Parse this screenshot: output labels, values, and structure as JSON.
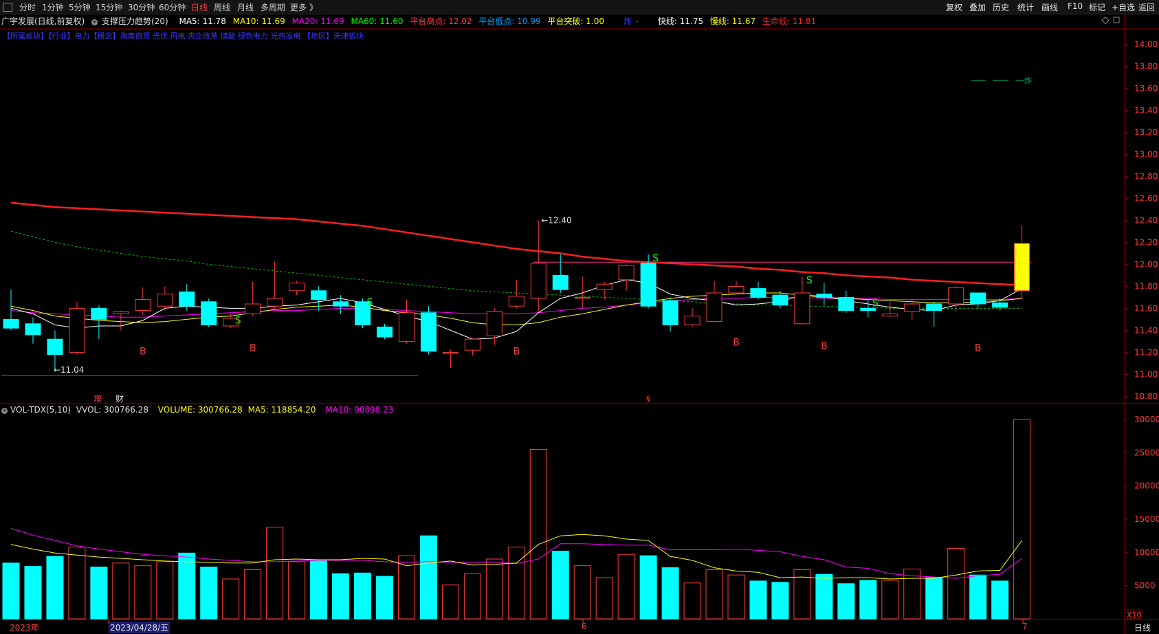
{
  "toolbar": {
    "periods": [
      "分时",
      "1分钟",
      "5分钟",
      "15分钟",
      "30分钟",
      "60分钟",
      "日线",
      "周线",
      "月线",
      "多周期",
      "更多 》"
    ],
    "active_period": "日线",
    "right_buttons": [
      "复权",
      "叠加",
      "历史",
      "统计",
      "画线",
      "F10",
      "标记",
      "+自选",
      "返回"
    ]
  },
  "header": {
    "stock": "广宇发展(日线,前复权)",
    "indicator": "支撑压力趋势(20)",
    "ma5": "MA5: 11.78",
    "ma10": "MA10: 11.69",
    "ma20": "MA20: 11.69",
    "ma60": "MA60: 11.60",
    "platform_high": "平台高点: 12.02",
    "platform_low": "平台低点: 10.99",
    "platform_break": "平台突破: 1.00",
    "zha": "炸",
    "fast_line": "快线: 11.75",
    "slow_line": "慢线: 11.67",
    "life_line": "生命线: 11.81"
  },
  "tags": "【所属板块】【行业】电力【概念】海南自贸 光伏 风电 央企改革 储能 绿色电力 光热发电 【地区】天津板块",
  "price_axis": [
    "14.00",
    "13.80",
    "13.60",
    "13.40",
    "13.20",
    "13.00",
    "12.80",
    "12.60",
    "12.40",
    "12.20",
    "12.00",
    "11.80",
    "11.60",
    "11.40",
    "11.20",
    "11.00",
    "10.80"
  ],
  "annotations": {
    "high": "12.40",
    "low": "11.04",
    "legend_zha": "炸",
    "zeng": "增",
    "cai": "财",
    "s_marks": [
      "S",
      "S",
      "S",
      "S",
      "S"
    ],
    "b_marks": [
      "B",
      "B",
      "B",
      "B",
      "B",
      "B"
    ]
  },
  "volume": {
    "title": "VOL-TDX(5,10)",
    "vvol": "VVOL: 300766.28",
    "volume": "VOLUME: 300766.28",
    "ma5": "MA5: 118854.20",
    "ma10": "MA10: 90898.23",
    "axis": [
      "30000",
      "25000",
      "20000",
      "15000",
      "10000",
      "5000"
    ],
    "unit": "X10"
  },
  "xaxis": {
    "year": "2023年",
    "cursor_date": "2023/04/28/五",
    "m6": "6",
    "m7": "7",
    "period": "日线"
  },
  "colors": {
    "up": "#ff3b3b",
    "down": "#00ffff",
    "ma5": "#ffffff",
    "ma10": "#ffff00",
    "ma20": "#ff00ff",
    "ma60": "#00ff00",
    "life": "#ff2020"
  },
  "chart_data": {
    "type": "candlestick",
    "candles": [
      {
        "o": 11.5,
        "h": 11.77,
        "l": 11.4,
        "c": 11.42
      },
      {
        "o": 11.46,
        "h": 11.52,
        "l": 11.28,
        "c": 11.36
      },
      {
        "o": 11.32,
        "h": 11.4,
        "l": 11.04,
        "c": 11.18
      },
      {
        "o": 11.2,
        "h": 11.66,
        "l": 11.18,
        "c": 11.6
      },
      {
        "o": 11.6,
        "h": 11.63,
        "l": 11.32,
        "c": 11.5
      },
      {
        "o": 11.55,
        "h": 11.58,
        "l": 11.4,
        "c": 11.57
      },
      {
        "o": 11.58,
        "h": 11.79,
        "l": 11.54,
        "c": 11.68
      },
      {
        "o": 11.62,
        "h": 11.8,
        "l": 11.58,
        "c": 11.73
      },
      {
        "o": 11.75,
        "h": 11.82,
        "l": 11.58,
        "c": 11.62
      },
      {
        "o": 11.66,
        "h": 11.69,
        "l": 11.43,
        "c": 11.45
      },
      {
        "o": 11.44,
        "h": 11.55,
        "l": 11.42,
        "c": 11.51
      },
      {
        "o": 11.55,
        "h": 11.84,
        "l": 11.53,
        "c": 11.64
      },
      {
        "o": 11.62,
        "h": 12.03,
        "l": 11.58,
        "c": 11.69
      },
      {
        "o": 11.76,
        "h": 11.85,
        "l": 11.72,
        "c": 11.83
      },
      {
        "o": 11.76,
        "h": 11.8,
        "l": 11.58,
        "c": 11.68
      },
      {
        "o": 11.66,
        "h": 11.72,
        "l": 11.55,
        "c": 11.62
      },
      {
        "o": 11.66,
        "h": 11.69,
        "l": 11.42,
        "c": 11.45
      },
      {
        "o": 11.43,
        "h": 11.46,
        "l": 11.32,
        "c": 11.34
      },
      {
        "o": 11.3,
        "h": 11.68,
        "l": 11.28,
        "c": 11.56
      },
      {
        "o": 11.56,
        "h": 11.62,
        "l": 11.18,
        "c": 11.21
      },
      {
        "o": 11.19,
        "h": 11.22,
        "l": 11.06,
        "c": 11.2
      },
      {
        "o": 11.22,
        "h": 11.33,
        "l": 11.17,
        "c": 11.32
      },
      {
        "o": 11.35,
        "h": 11.6,
        "l": 11.27,
        "c": 11.57
      },
      {
        "o": 11.62,
        "h": 11.86,
        "l": 11.6,
        "c": 11.71
      },
      {
        "o": 11.69,
        "h": 12.4,
        "l": 11.58,
        "c": 12.01
      },
      {
        "o": 11.9,
        "h": 12.09,
        "l": 11.74,
        "c": 11.77
      },
      {
        "o": 11.7,
        "h": 11.89,
        "l": 11.6,
        "c": 11.7
      },
      {
        "o": 11.77,
        "h": 11.84,
        "l": 11.68,
        "c": 11.82
      },
      {
        "o": 11.86,
        "h": 12.0,
        "l": 11.76,
        "c": 11.99
      },
      {
        "o": 12.01,
        "h": 12.09,
        "l": 11.6,
        "c": 11.62
      },
      {
        "o": 11.67,
        "h": 11.7,
        "l": 11.39,
        "c": 11.45
      },
      {
        "o": 11.45,
        "h": 11.6,
        "l": 11.43,
        "c": 11.53
      },
      {
        "o": 11.48,
        "h": 11.85,
        "l": 11.47,
        "c": 11.74
      },
      {
        "o": 11.74,
        "h": 11.85,
        "l": 11.73,
        "c": 11.8
      },
      {
        "o": 11.78,
        "h": 11.84,
        "l": 11.68,
        "c": 11.7
      },
      {
        "o": 11.72,
        "h": 11.76,
        "l": 11.6,
        "c": 11.63
      },
      {
        "o": 11.46,
        "h": 11.89,
        "l": 11.45,
        "c": 11.74
      },
      {
        "o": 11.73,
        "h": 11.83,
        "l": 11.63,
        "c": 11.7
      },
      {
        "o": 11.7,
        "h": 11.76,
        "l": 11.56,
        "c": 11.58
      },
      {
        "o": 11.6,
        "h": 11.68,
        "l": 11.52,
        "c": 11.58
      },
      {
        "o": 11.53,
        "h": 11.66,
        "l": 11.52,
        "c": 11.55
      },
      {
        "o": 11.57,
        "h": 11.68,
        "l": 11.49,
        "c": 11.64
      },
      {
        "o": 11.64,
        "h": 11.66,
        "l": 11.43,
        "c": 11.58
      },
      {
        "o": 11.64,
        "h": 11.8,
        "l": 11.57,
        "c": 11.79
      },
      {
        "o": 11.74,
        "h": 11.74,
        "l": 11.6,
        "c": 11.64
      },
      {
        "o": 11.65,
        "h": 11.69,
        "l": 11.58,
        "c": 11.61
      },
      {
        "o": 11.76,
        "h": 12.35,
        "l": 11.68,
        "c": 12.19
      }
    ],
    "ma5": [
      11.6,
      11.55,
      11.45,
      11.42,
      11.44,
      11.44,
      11.49,
      11.6,
      11.62,
      11.61,
      11.6,
      11.6,
      11.62,
      11.63,
      11.66,
      11.69,
      11.65,
      11.59,
      11.53,
      11.48,
      11.4,
      11.32,
      11.33,
      11.39,
      11.56,
      11.69,
      11.74,
      11.81,
      11.86,
      11.83,
      11.73,
      11.69,
      11.67,
      11.63,
      11.64,
      11.66,
      11.72,
      11.71,
      11.67,
      11.64,
      11.61,
      11.59,
      11.58,
      11.63,
      11.64,
      11.67,
      11.78
    ],
    "ma10": [
      11.62,
      11.58,
      11.53,
      11.51,
      11.49,
      11.48,
      11.47,
      11.48,
      11.5,
      11.52,
      11.53,
      11.56,
      11.59,
      11.61,
      11.62,
      11.63,
      11.61,
      11.58,
      11.56,
      11.54,
      11.51,
      11.47,
      11.45,
      11.45,
      11.47,
      11.52,
      11.55,
      11.59,
      11.63,
      11.66,
      11.69,
      11.71,
      11.72,
      11.73,
      11.74,
      11.74,
      11.72,
      11.7,
      11.69,
      11.68,
      11.67,
      11.66,
      11.65,
      11.65,
      11.66,
      11.67,
      11.69
    ],
    "ma20": [
      11.58,
      11.56,
      11.55,
      11.54,
      11.53,
      11.52,
      11.52,
      11.53,
      11.54,
      11.55,
      11.56,
      11.57,
      11.58,
      11.58,
      11.59,
      11.6,
      11.6,
      11.59,
      11.58,
      11.57,
      11.56,
      11.55,
      11.55,
      11.55,
      11.56,
      11.58,
      11.6,
      11.61,
      11.63,
      11.65,
      11.67,
      11.68,
      11.69,
      11.69,
      11.7,
      11.7,
      11.7,
      11.69,
      11.69,
      11.69,
      11.68,
      11.68,
      11.68,
      11.68,
      11.68,
      11.68,
      11.69
    ],
    "ma60": [
      12.3,
      12.25,
      12.2,
      12.16,
      12.13,
      12.1,
      12.07,
      12.05,
      12.03,
      12.0,
      11.98,
      11.96,
      11.94,
      11.92,
      11.9,
      11.88,
      11.86,
      11.84,
      11.82,
      11.8,
      11.78,
      11.76,
      11.75,
      11.74,
      11.73,
      11.72,
      11.71,
      11.7,
      11.69,
      11.68,
      11.67,
      11.66,
      11.65,
      11.64,
      11.63,
      11.63,
      11.62,
      11.62,
      11.61,
      11.61,
      11.6,
      11.6,
      11.6,
      11.6,
      11.6,
      11.6,
      11.6
    ],
    "life_line": [
      12.56,
      12.54,
      12.52,
      12.51,
      12.5,
      12.49,
      12.48,
      12.47,
      12.46,
      12.45,
      12.44,
      12.43,
      12.42,
      12.41,
      12.39,
      12.37,
      12.35,
      12.32,
      12.29,
      12.26,
      12.23,
      12.2,
      12.17,
      12.14,
      12.12,
      12.1,
      12.07,
      12.05,
      12.03,
      12.02,
      12.01,
      12.0,
      11.99,
      11.98,
      11.96,
      11.95,
      11.93,
      11.92,
      11.9,
      11.89,
      11.88,
      11.86,
      11.85,
      11.84,
      11.83,
      11.82,
      11.81
    ],
    "platform_high": 12.02,
    "platform_low": 10.99,
    "vol": [
      8400,
      7900,
      9400,
      10800,
      7800,
      8400,
      8000,
      8600,
      9900,
      7800,
      6000,
      7400,
      13800,
      8600,
      8700,
      6800,
      6900,
      6400,
      9500,
      12500,
      5100,
      6800,
      9000,
      10800,
      25500,
      10200,
      8000,
      6200,
      9700,
      9500,
      7700,
      5400,
      7400,
      6600,
      5700,
      5500,
      7400,
      6700,
      5300,
      5800,
      5800,
      7500,
      6200,
      10600,
      6600,
      5700,
      30000
    ],
    "vol_ma5": [
      11200,
      10500,
      9900,
      9600,
      9300,
      9100,
      8900,
      8700,
      8600,
      8500,
      8400,
      8400,
      8900,
      9000,
      8900,
      8900,
      9100,
      9000,
      8000,
      8400,
      8700,
      8100,
      8200,
      8400,
      11200,
      12500,
      12700,
      12500,
      12000,
      11800,
      9400,
      8800,
      7700,
      7200,
      7000,
      6200,
      6300,
      6100,
      6200,
      6200,
      6000,
      6100,
      6100,
      6600,
      7200,
      7300,
      11800
    ],
    "vol_ma10": [
      13600,
      12600,
      11800,
      11000,
      10500,
      10100,
      9700,
      9500,
      9300,
      9000,
      8800,
      8600,
      8600,
      8700,
      8800,
      8800,
      8800,
      8600,
      8500,
      8600,
      8500,
      8500,
      8500,
      8300,
      9000,
      11300,
      11300,
      11200,
      11100,
      11100,
      10400,
      10400,
      10400,
      10500,
      10300,
      10100,
      9400,
      8900,
      7800,
      7600,
      6800,
      6500,
      6300,
      6100,
      6500,
      6700,
      9100
    ],
    "vol_axis_max": 30000,
    "price_range": [
      10.74,
      14.14
    ]
  }
}
